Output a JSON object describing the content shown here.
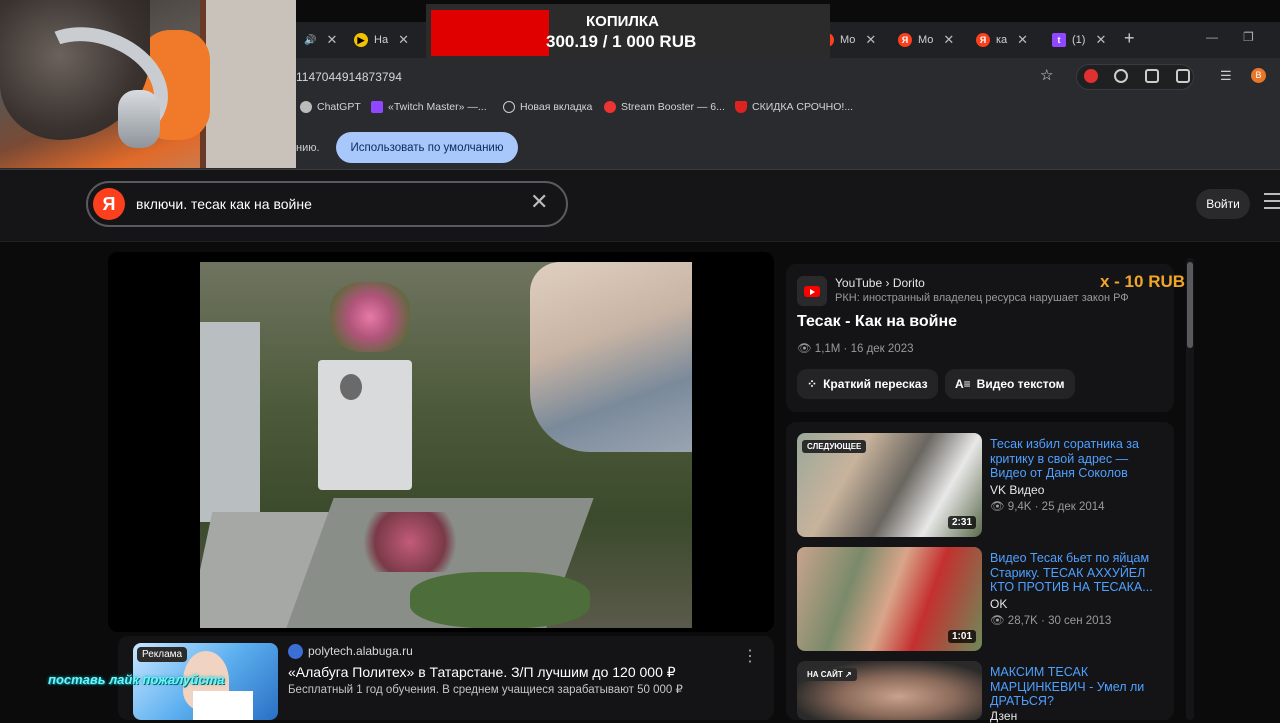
{
  "overlay": {
    "goal_title": "КОПИЛКА",
    "goal_amount": "300.19 / 1 000 RUB",
    "rub_badge": "x - 10 RUB",
    "like_text": "поставь лайк пожалуйста"
  },
  "browser": {
    "tabs": [
      {
        "label": "На",
        "favicon": "play-icon",
        "color": "#f2c200"
      },
      {
        "label": "МС",
        "favicon": "yandex-icon",
        "color": "#fc3f1d"
      },
      {
        "label": "Мо",
        "favicon": "yandex-icon",
        "color": "#fc3f1d"
      },
      {
        "label": "Мо",
        "favicon": "yandex-icon",
        "color": "#fc3f1d"
      },
      {
        "label": "ка",
        "favicon": "yandex-icon",
        "color": "#fc3f1d"
      },
      {
        "label": "(1)",
        "favicon": "twitch-icon",
        "color": "#9146ff"
      }
    ],
    "url": "1147044914873794",
    "bookmarks": [
      "ChatGPT",
      "«Twitch Master» —...",
      "Новая вкладка",
      "Stream Booster — 6...",
      "СКИДКА СРОЧНО!..."
    ],
    "profile_initial": "B",
    "infobar_text": "нию.",
    "default_button": "Использовать по умолчанию"
  },
  "header": {
    "logo": "Я",
    "search_query": "включи. тесак как на войне",
    "login": "Войти"
  },
  "video": {
    "source": "YouTube › Dorito",
    "warning": "РКН: иностранный владелец ресурса нарушает закон РФ",
    "title": "Тесак - Как на войне",
    "meta": "1,1M · 16 дек 2023",
    "chip_summary": "Краткий пересказ",
    "chip_text": "Видео текстом"
  },
  "ad": {
    "tag": "Реклама",
    "domain": "polytech.alabuga.ru",
    "title": "«Алабуга Политех» в Татарстане. З/П лучшим до 120 000 ₽",
    "desc": "Бесплатный 1 год обучения. В среднем учащиеся зарабатывают 50 000 ₽"
  },
  "related": [
    {
      "badge": "СЛЕДУЮЩЕЕ",
      "duration": "2:31",
      "title": "Тесак избил соратника за критику в свой адрес — Видео от Даня Соколов",
      "source": "VK Видео",
      "meta": "9,4K · 25 дек 2014"
    },
    {
      "badge": "",
      "duration": "1:01",
      "title": "Видео Тесак бьет по яйцам Старику. ТЕСАК АХХУЙЕЛ КТО ПРОТИВ НА ТЕСАКА...",
      "source": "OK",
      "meta": "28,7K · 30 сен 2013"
    },
    {
      "badge": "НА САЙТ ↗",
      "duration": "",
      "title": "МАКСИМ ТЕСАК МАРЦИНКЕВИЧ - Умел ли ДРАТЬСЯ?",
      "source": "Дзен",
      "meta": ""
    }
  ]
}
